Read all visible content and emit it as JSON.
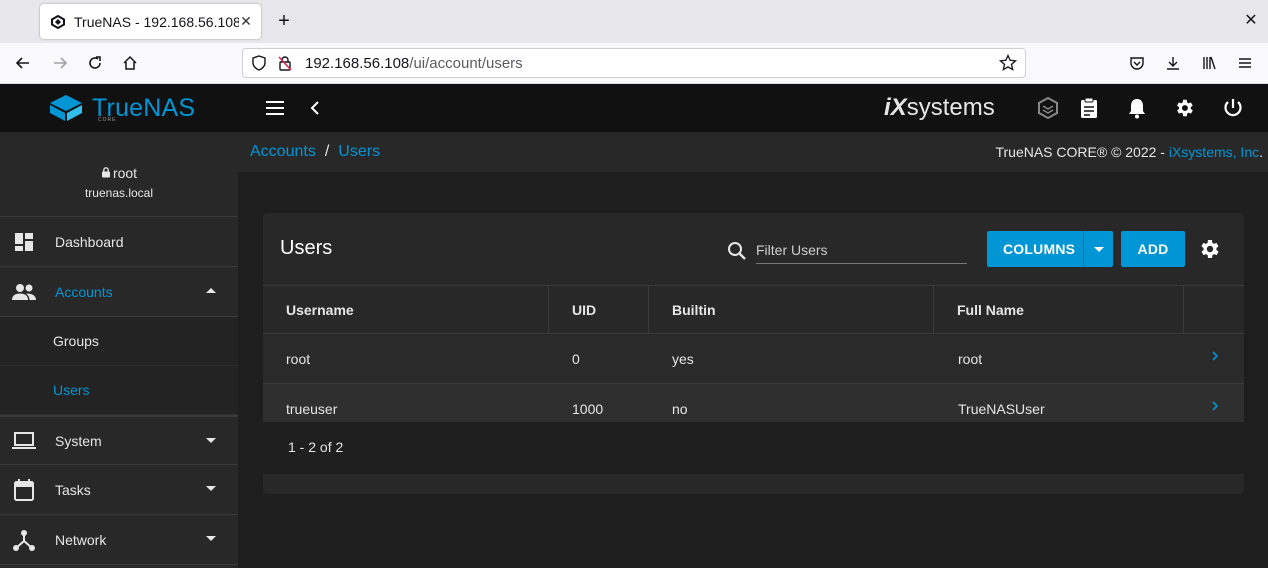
{
  "browser": {
    "tab_title": "TrueNAS - 192.168.56.108",
    "url_host": "192.168.56.108",
    "url_path": "/ui/account/users"
  },
  "app": {
    "brand": "TrueNAS",
    "brand_sub": "CORE",
    "partner_logo_ix": "iX",
    "partner_logo_text": "systems"
  },
  "sidebar": {
    "username": "root",
    "hostname": "truenas.local",
    "items": [
      {
        "label": "Dashboard",
        "icon": "dashboard-icon"
      },
      {
        "label": "Accounts",
        "icon": "people-icon"
      },
      {
        "label": "System",
        "icon": "laptop-icon"
      },
      {
        "label": "Tasks",
        "icon": "calendar-icon"
      },
      {
        "label": "Network",
        "icon": "network-icon"
      }
    ],
    "subitems": [
      {
        "label": "Groups"
      },
      {
        "label": "Users"
      }
    ]
  },
  "breadcrumb": {
    "parent": "Accounts",
    "separator": "/",
    "current": "Users"
  },
  "copyright": {
    "text": "TrueNAS CORE® © 2022 - ",
    "link": "iXsystems, Inc",
    "suffix": "."
  },
  "users_card": {
    "title": "Users",
    "filter_placeholder": "Filter Users",
    "columns_label": "COLUMNS",
    "add_label": "ADD",
    "headers": [
      "Username",
      "UID",
      "Builtin",
      "Full Name"
    ],
    "rows": [
      {
        "username": "root",
        "uid": "0",
        "builtin": "yes",
        "full_name": "root"
      },
      {
        "username": "trueuser",
        "uid": "1000",
        "builtin": "no",
        "full_name": "TrueNASUser"
      }
    ],
    "pagination": "1 - 2 of 2"
  },
  "colors": {
    "accent": "#0095d5",
    "header_bg": "#111111",
    "sidebar_bg": "#282828"
  }
}
